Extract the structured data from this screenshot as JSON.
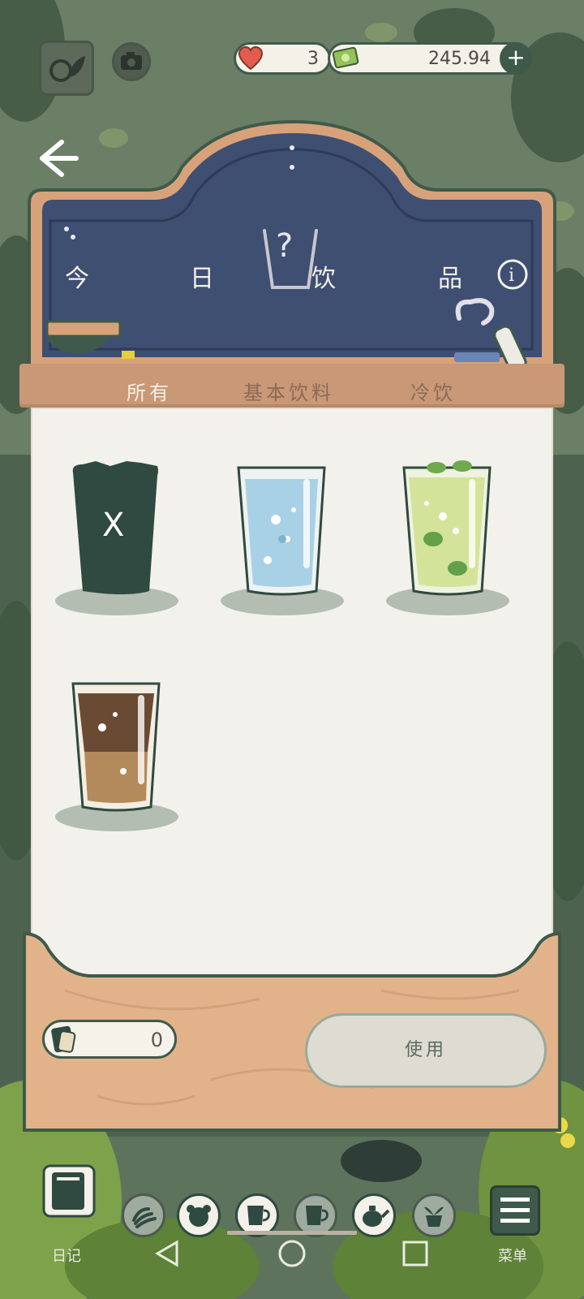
{
  "hud": {
    "hearts": "3",
    "money": "245.94",
    "add_label": "+"
  },
  "board": {
    "title_chars": [
      "今",
      "日",
      "饮",
      "品"
    ],
    "info_label": "i"
  },
  "tabs": [
    {
      "label": "所有",
      "active": true
    },
    {
      "label": "基本饮料",
      "active": false
    },
    {
      "label": "冷饮",
      "active": false
    }
  ],
  "drinks": [
    {
      "name": "locked",
      "mark": "X"
    },
    {
      "name": "water",
      "mark": ""
    },
    {
      "name": "mint-soda",
      "mark": ""
    },
    {
      "name": "iced-coffee",
      "mark": ""
    }
  ],
  "ticket": {
    "count": "0"
  },
  "use_button": {
    "label": "使用"
  },
  "bottom_bar": {
    "diary_label": "日记",
    "menu_label": "菜单"
  },
  "colors": {
    "board": "#3e4f72",
    "trim": "#d7a279",
    "wood": "#e2b38a",
    "paper": "#f3f1ec",
    "dark_green": "#2f4a40"
  }
}
